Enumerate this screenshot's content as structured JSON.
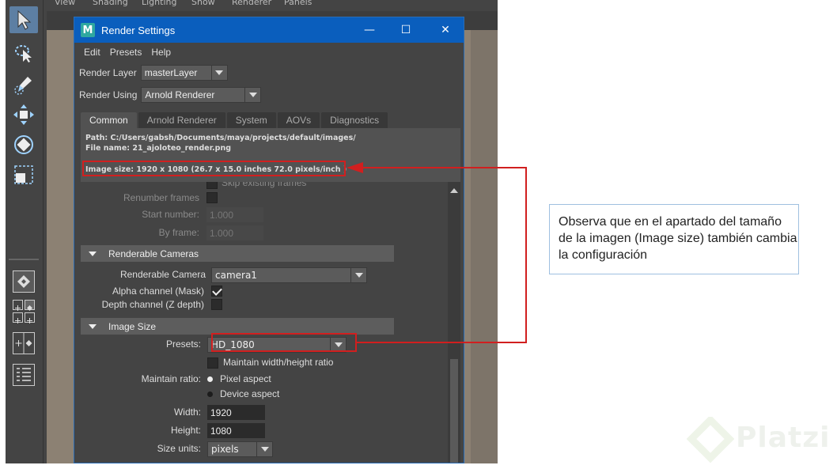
{
  "maya": {
    "menubar": [
      "View",
      "Shading",
      "Lighting",
      "Show",
      "Renderer",
      "Panels"
    ]
  },
  "window": {
    "title": "Render Settings",
    "app_icon_letter": "M",
    "menu": [
      "Edit",
      "Presets",
      "Help"
    ],
    "controls": {
      "minimize": "—",
      "maximize": "☐",
      "close": "✕"
    },
    "render_layer": {
      "label": "Render Layer",
      "value": "masterLayer"
    },
    "render_using": {
      "label": "Render Using",
      "value": "Arnold Renderer"
    },
    "tabs": [
      "Common",
      "Arnold Renderer",
      "System",
      "AOVs",
      "Diagnostics"
    ],
    "active_tab": "Common",
    "path_line": "Path: C:/Users/gabsh/Documents/maya/projects/default/images/",
    "file_name_line": "File name:  21_ajoloteo_render.png",
    "image_size_line": "Image size: 1920 x 1080 (26.7 x 15.0 inches 72.0 pixels/inch )"
  },
  "settings": {
    "skip_existing_frames": "Skip existing frames",
    "renumber_frames": "Renumber frames",
    "start_number": {
      "label": "Start number:",
      "value": "1.000"
    },
    "by_frame": {
      "label": "By frame:",
      "value": "1.000"
    },
    "renderable_cameras": {
      "header": "Renderable Cameras",
      "camera_label": "Renderable Camera",
      "camera_value": "camera1",
      "alpha_label": "Alpha channel (Mask)",
      "alpha_checked": true,
      "depth_label": "Depth channel (Z depth)",
      "depth_checked": false
    },
    "image_size": {
      "header": "Image Size",
      "presets_label": "Presets:",
      "presets_value": "HD_1080",
      "maintain_ratio_checkbox": "Maintain width/height ratio",
      "maintain_ratio_label": "Maintain ratio:",
      "pixel_aspect": "Pixel aspect",
      "device_aspect": "Device aspect",
      "selected_ratio": "Pixel aspect",
      "width_label": "Width:",
      "width_value": "1920",
      "height_label": "Height:",
      "height_value": "1080",
      "size_units_label": "Size units:",
      "size_units_value": "pixels"
    }
  },
  "callout": {
    "text": "Observa que en el apartado del tamaño de la imagen (Image size) también cambia la configuración"
  },
  "watermark": {
    "text": "Platzi"
  },
  "colors": {
    "highlight": "#d11f1f",
    "titlebar": "#0a5ebd",
    "callout_border": "#9fc0e0"
  }
}
